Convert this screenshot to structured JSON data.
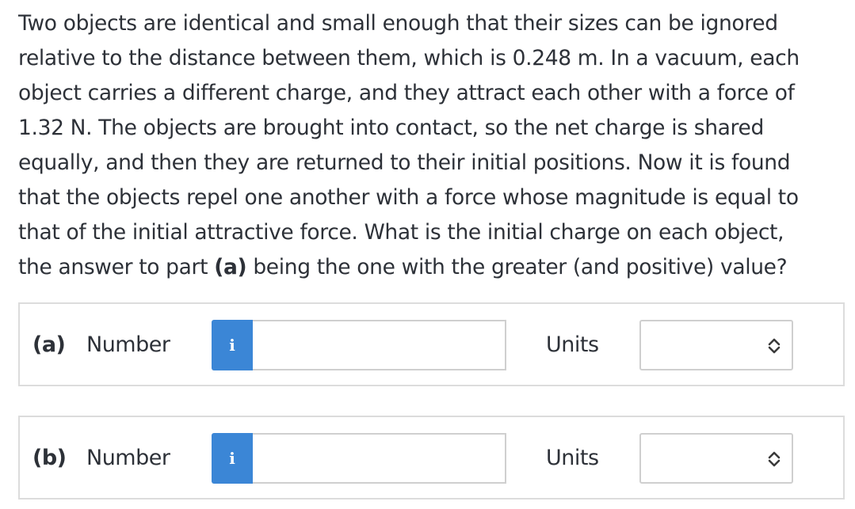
{
  "question": {
    "lines": [
      "Two objects are identical and small enough that their sizes can be ignored",
      "relative to the distance between them, which is 0.248 m. In a vacuum, each",
      "object carries a different charge, and they attract each other with a force of",
      "1.32 N. The objects are brought into contact, so the net charge is shared",
      "equally, and then they are returned to their initial positions. Now it is found",
      "that the objects repel one another with a force whose magnitude is equal to",
      "that of the initial attractive force. What is the initial charge on each object,"
    ],
    "last_line_before": "the answer to part ",
    "last_line_bold": "(a)",
    "last_line_after": " being the one with the greater (and positive) value?"
  },
  "parts": [
    {
      "label": "(a)",
      "number_label": "Number",
      "info_icon": "i",
      "number_value": "",
      "units_label": "Units",
      "units_selected": ""
    },
    {
      "label": "(b)",
      "number_label": "Number",
      "info_icon": "i",
      "number_value": "",
      "units_label": "Units",
      "units_selected": ""
    }
  ]
}
